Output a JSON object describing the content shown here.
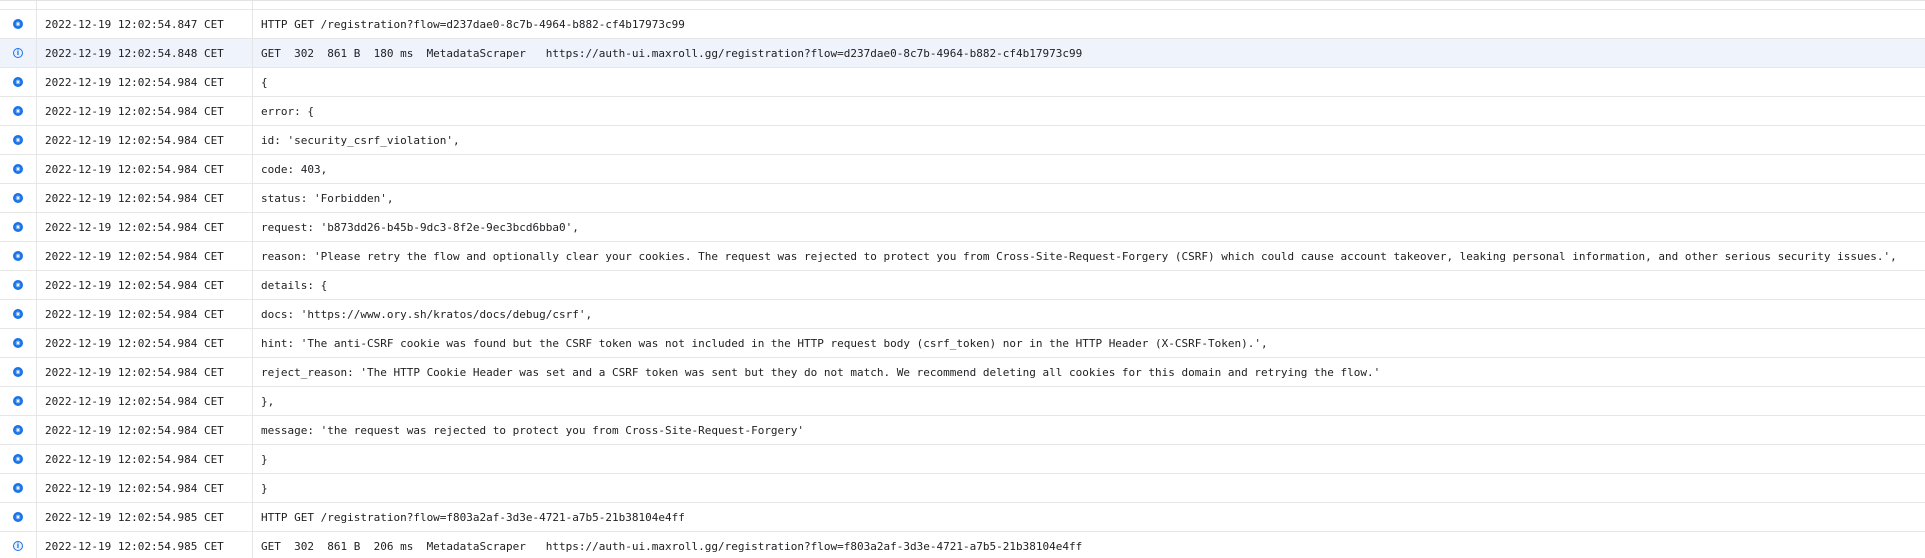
{
  "colors": {
    "accent": "#1a73e8",
    "row_highlight": "#eef3fc",
    "border": "#e6e6e6"
  },
  "rows": [
    {
      "severity": "debug-icon",
      "timestamp": "2022-12-19 12:02:54.847 CET",
      "message": "HTTP GET /registration?flow=d237dae0-8c7b-4964-b882-cf4b17973c99"
    },
    {
      "severity": "info-icon",
      "timestamp": "2022-12-19 12:02:54.848 CET",
      "message": "GET  302  861 B  180 ms  MetadataScraper   https://auth-ui.maxroll.gg/registration?flow=d237dae0-8c7b-4964-b882-cf4b17973c99",
      "highlighted": true
    },
    {
      "severity": "debug-icon",
      "timestamp": "2022-12-19 12:02:54.984 CET",
      "message": "{"
    },
    {
      "severity": "debug-icon",
      "timestamp": "2022-12-19 12:02:54.984 CET",
      "message": "error: {"
    },
    {
      "severity": "debug-icon",
      "timestamp": "2022-12-19 12:02:54.984 CET",
      "message": "id: 'security_csrf_violation',"
    },
    {
      "severity": "debug-icon",
      "timestamp": "2022-12-19 12:02:54.984 CET",
      "message": "code: 403,"
    },
    {
      "severity": "debug-icon",
      "timestamp": "2022-12-19 12:02:54.984 CET",
      "message": "status: 'Forbidden',"
    },
    {
      "severity": "debug-icon",
      "timestamp": "2022-12-19 12:02:54.984 CET",
      "message": "request: 'b873dd26-b45b-9dc3-8f2e-9ec3bcd6bba0',"
    },
    {
      "severity": "debug-icon",
      "timestamp": "2022-12-19 12:02:54.984 CET",
      "message": "reason: 'Please retry the flow and optionally clear your cookies. The request was rejected to protect you from Cross-Site-Request-Forgery (CSRF) which could cause account takeover, leaking personal information, and other serious security issues.',"
    },
    {
      "severity": "debug-icon",
      "timestamp": "2022-12-19 12:02:54.984 CET",
      "message": "details: {"
    },
    {
      "severity": "debug-icon",
      "timestamp": "2022-12-19 12:02:54.984 CET",
      "message": "docs: 'https://www.ory.sh/kratos/docs/debug/csrf',"
    },
    {
      "severity": "debug-icon",
      "timestamp": "2022-12-19 12:02:54.984 CET",
      "message": "hint: 'The anti-CSRF cookie was found but the CSRF token was not included in the HTTP request body (csrf_token) nor in the HTTP Header (X-CSRF-Token).',"
    },
    {
      "severity": "debug-icon",
      "timestamp": "2022-12-19 12:02:54.984 CET",
      "message": "reject_reason: 'The HTTP Cookie Header was set and a CSRF token was sent but they do not match. We recommend deleting all cookies for this domain and retrying the flow.'"
    },
    {
      "severity": "debug-icon",
      "timestamp": "2022-12-19 12:02:54.984 CET",
      "message": "},"
    },
    {
      "severity": "debug-icon",
      "timestamp": "2022-12-19 12:02:54.984 CET",
      "message": "message: 'the request was rejected to protect you from Cross-Site-Request-Forgery'"
    },
    {
      "severity": "debug-icon",
      "timestamp": "2022-12-19 12:02:54.984 CET",
      "message": "}"
    },
    {
      "severity": "debug-icon",
      "timestamp": "2022-12-19 12:02:54.984 CET",
      "message": "}"
    },
    {
      "severity": "debug-icon",
      "timestamp": "2022-12-19 12:02:54.985 CET",
      "message": "HTTP GET /registration?flow=f803a2af-3d3e-4721-a7b5-21b38104e4ff"
    },
    {
      "severity": "info-icon",
      "timestamp": "2022-12-19 12:02:54.985 CET",
      "message": "GET  302  861 B  206 ms  MetadataScraper   https://auth-ui.maxroll.gg/registration?flow=f803a2af-3d3e-4721-a7b5-21b38104e4ff"
    }
  ]
}
